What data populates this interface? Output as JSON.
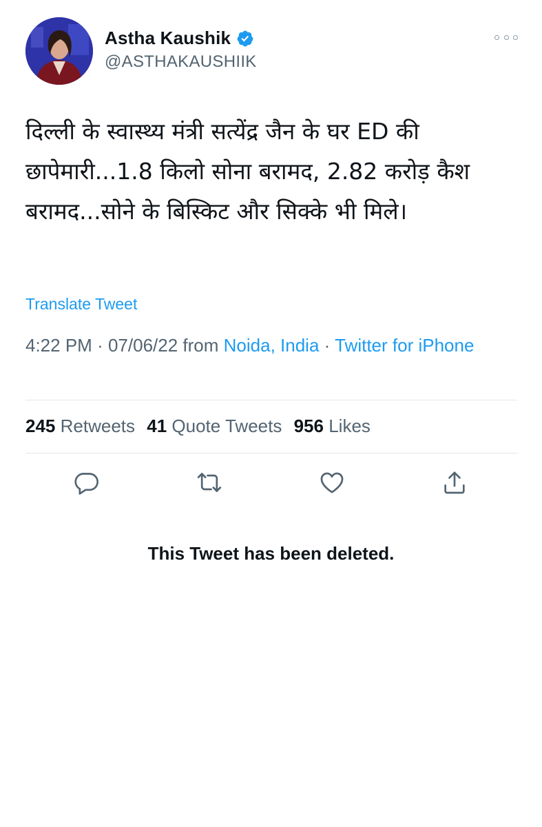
{
  "author": {
    "display_name": "Astha Kaushik",
    "handle": "@ASTHAKAUSHIIK",
    "verified": true
  },
  "tweet": {
    "text": "दिल्ली के स्वास्थ्य मंत्री सत्येंद्र जैन के घर ED की छापेमारी...1.8 किलो सोना बरामद, 2.82 करोड़ कैश बरामद...सोने के बिस्किट और सिक्के भी मिले।",
    "translate_label": "Translate Tweet",
    "time": "4:22 PM",
    "date": "07/06/22",
    "from_label": "from",
    "location": "Noida, India",
    "separator": "·",
    "source": "Twitter for iPhone"
  },
  "stats": {
    "retweets_count": "245",
    "retweets_label": "Retweets",
    "quote_tweets_count": "41",
    "quote_tweets_label": "Quote Tweets",
    "likes_count": "956",
    "likes_label": "Likes"
  },
  "actions": [
    "reply-icon",
    "retweet-icon",
    "like-icon",
    "share-icon"
  ],
  "deleted_notice": "This Tweet has been deleted.",
  "colors": {
    "accent": "#1d9bf0",
    "text_primary": "#0f1419",
    "text_secondary": "#536471",
    "divider": "#e3e6e9"
  }
}
